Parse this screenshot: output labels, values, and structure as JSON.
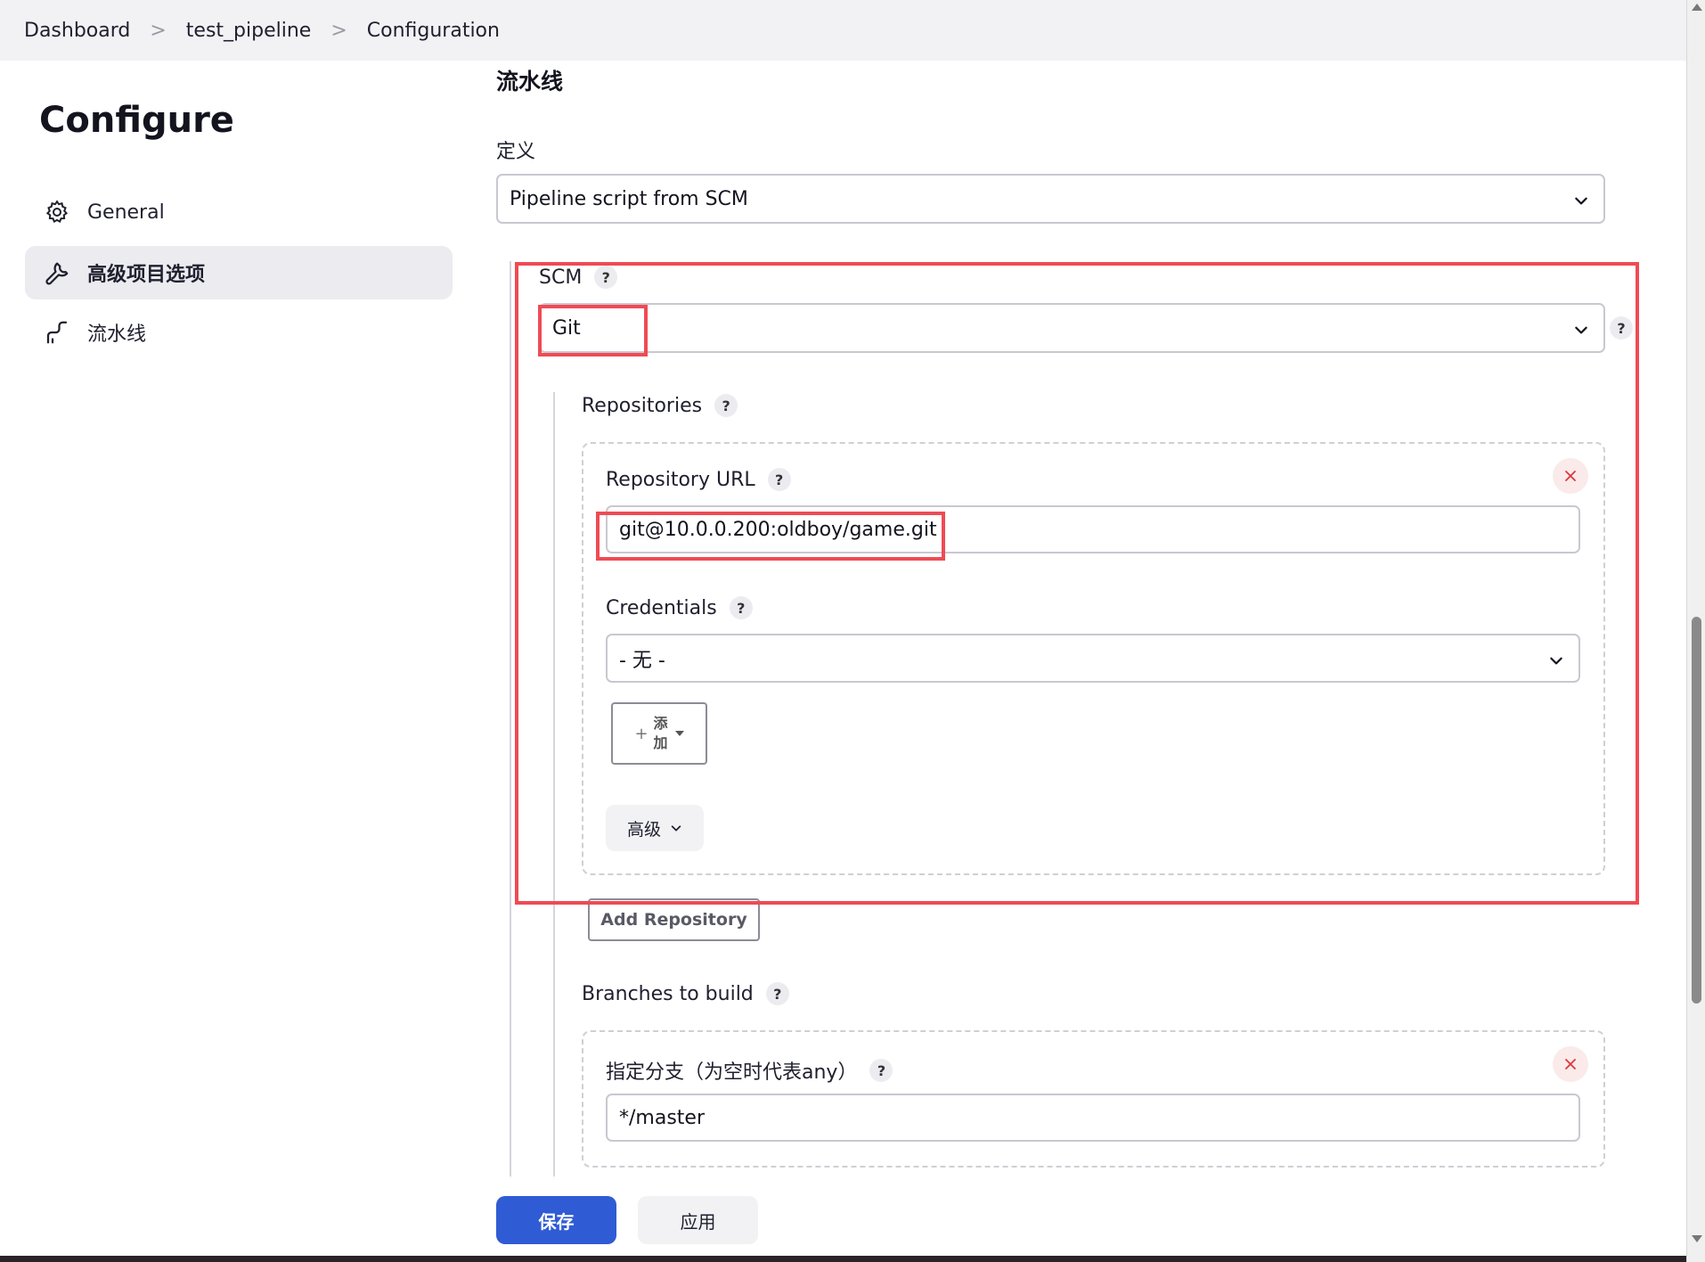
{
  "breadcrumb": {
    "items": [
      "Dashboard",
      "test_pipeline",
      "Configuration"
    ],
    "separator": ">"
  },
  "sidebar": {
    "heading": "Configure",
    "items": [
      {
        "label": "General",
        "icon": "gear-icon",
        "active": false
      },
      {
        "label": "高级项目选项",
        "icon": "wrench-icon",
        "active": true
      },
      {
        "label": "流水线",
        "icon": "pipeline-icon",
        "active": false
      }
    ]
  },
  "pipeline": {
    "section_title": "流水线",
    "definition_label": "定义",
    "definition_value": "Pipeline script from SCM",
    "scm_label": "SCM",
    "scm_value": "Git",
    "help_glyph": "?",
    "repositories_label": "Repositories",
    "repository": {
      "url_label": "Repository URL",
      "url_value": "git@10.0.0.200:oldboy/game.git",
      "credentials_label": "Credentials",
      "credentials_value": "- 无 -",
      "add_button_label": "添加",
      "advanced_label": "高级"
    },
    "add_repository_label": "Add Repository",
    "branches_label": "Branches to build",
    "branch": {
      "specifier_label": "指定分支（为空时代表any）",
      "specifier_value": "*/master"
    }
  },
  "actions": {
    "save_label": "保存",
    "apply_label": "应用"
  },
  "colors": {
    "primary": "#2f5bd4",
    "highlight": "#ef4b55",
    "active_bg": "#ebebf0",
    "close_icon": "#d9373f"
  }
}
